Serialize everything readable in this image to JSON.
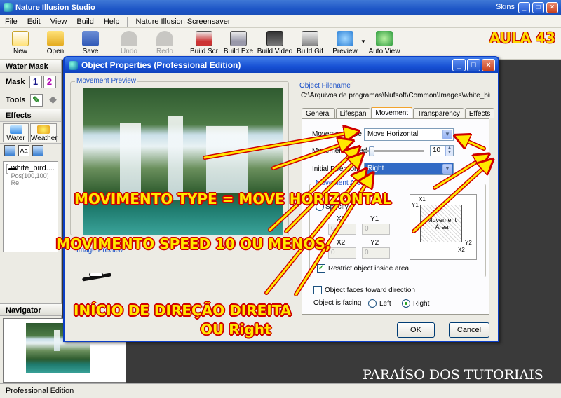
{
  "app": {
    "title": "Nature Illusion Studio",
    "skins_label": "Skins",
    "menu": [
      "File",
      "Edit",
      "View",
      "Build",
      "Help"
    ],
    "menu_extra": "Nature Illusion Screensaver",
    "toolbar": [
      "New",
      "Open",
      "Save",
      "Undo",
      "Redo",
      "Build Scr",
      "Build Exe",
      "Build Video",
      "Build Gif",
      "Preview",
      "Auto View"
    ],
    "status": "Professional Edition"
  },
  "left_panel": {
    "water_mask": "Water Mask",
    "mask_label": "Mask",
    "mask_buttons": [
      "1",
      "2"
    ],
    "tools_label": "Tools",
    "effects": "Effects",
    "effect_tabs": [
      "Water",
      "Weather"
    ],
    "object_name": "white_bird....",
    "object_pos": "Pos(100,100) Re",
    "navigator": "Navigator"
  },
  "dialog": {
    "title": "Object Properties (Professional Edition)",
    "movement_preview": "Movement Preview",
    "object_image": "Image Preview",
    "object_filename_label": "Object Filename",
    "object_filename": "C:\\Arquivos de programas\\Nufsoft\\Common\\Images\\white_bird.g",
    "tabs": [
      "General",
      "Lifespan",
      "Movement",
      "Transparency",
      "Effects"
    ],
    "active_tab": "Movement",
    "movement_type_label": "Movement Type",
    "movement_type": "Move Horizontal",
    "movement_speed_label": "Movement Speed",
    "movement_speed": "10",
    "movement_speed_fraction": 0.05,
    "initial_direction_label": "Initial Direction",
    "initial_direction": "Right",
    "movement_area_label": "Movement Area",
    "specify_label": "Specify",
    "x1_label": "X1",
    "y1_label": "Y1",
    "x2_label": "X2",
    "y2_label": "Y2",
    "x1": "0",
    "y1": "0",
    "x2": "0",
    "y2": "0",
    "diagram_x1": "X1",
    "diagram_y1": "Y1",
    "diagram_x2": "X2",
    "diagram_y2": "Y2",
    "diagram_label": "Movement Area",
    "restrict_label": "Restrict object inside area",
    "restrict_checked": true,
    "faces_label": "Object faces toward direction",
    "faces_checked": false,
    "facing_label": "Object is facing",
    "facing_left": "Left",
    "facing_right": "Right",
    "facing_value": "Right",
    "ok": "OK",
    "cancel": "Cancel"
  },
  "annotations": {
    "aula": "AULA 43",
    "type": "MOVIMENTO TYPE = MOVE HORIZONTAL",
    "speed": "MOVIMENTO SPEED 10 OU MENOS,",
    "direction_1": "INÍCIO DE DIREÇÃO DIREITA",
    "direction_2": "OU Right",
    "watermark": "PARAÍSO DOS TUTORIAIS",
    "text_color": "#ffe800",
    "outline_color": "#d00000"
  }
}
